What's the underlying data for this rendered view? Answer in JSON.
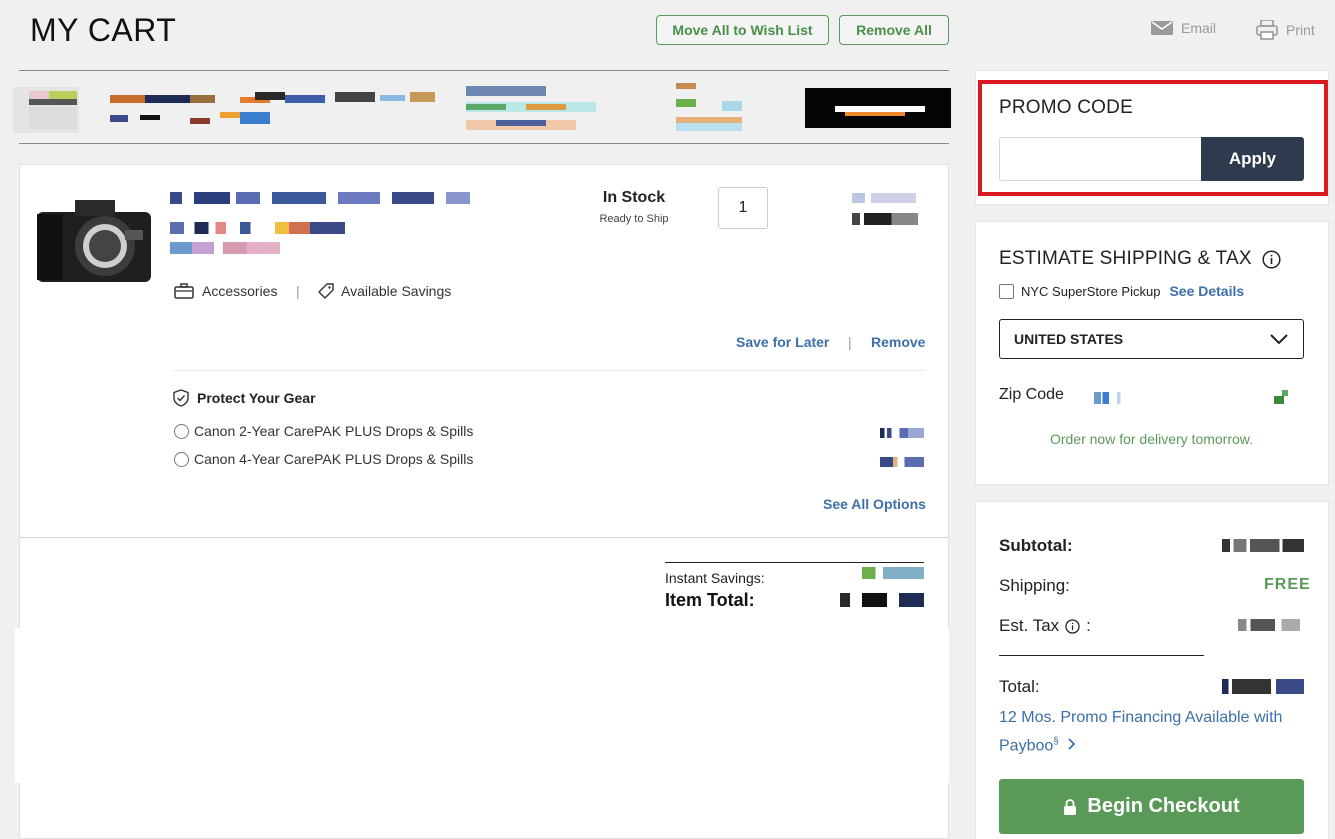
{
  "header": {
    "title": "MY CART",
    "move_all_label": "Move All to Wish List",
    "remove_all_label": "Remove All",
    "email_label": "Email",
    "print_label": "Print"
  },
  "item": {
    "stock_status": "In Stock",
    "ship_status": "Ready to Ship",
    "quantity": "1",
    "accessories_label": "Accessories",
    "savings_label": "Available Savings",
    "save_later_label": "Save for Later",
    "remove_label": "Remove",
    "protect_title": "Protect Your Gear",
    "protection_options": [
      "Canon 2-Year CarePAK PLUS Drops & Spills",
      "Canon 4-Year CarePAK PLUS Drops & Spills"
    ],
    "see_all_label": "See All Options",
    "instant_savings_label": "Instant Savings:",
    "item_total_label": "Item Total:"
  },
  "promo": {
    "title": "PROMO CODE",
    "input_value": "",
    "apply_label": "Apply"
  },
  "shipping": {
    "title": "ESTIMATE SHIPPING & TAX",
    "pickup_label": "NYC SuperStore Pickup",
    "see_details_label": "See Details",
    "country": "UNITED STATES",
    "zip_label": "Zip Code",
    "delivery_note": "Order now for delivery tomorrow."
  },
  "summary": {
    "subtotal_label": "Subtotal:",
    "shipping_label": "Shipping:",
    "shipping_value": "FREE",
    "tax_label": "Est. Tax",
    "tax_colon": ":",
    "total_label": "Total:",
    "financing_text": "12 Mos. Promo Financing Available with Payboo",
    "financing_sup": "§",
    "checkout_label": "Begin Checkout"
  },
  "colors": {
    "accent_green": "#5a9a58",
    "link_blue": "#3d6fa8",
    "apply_navy": "#2e3a4d",
    "highlight_red": "#d9181f"
  }
}
